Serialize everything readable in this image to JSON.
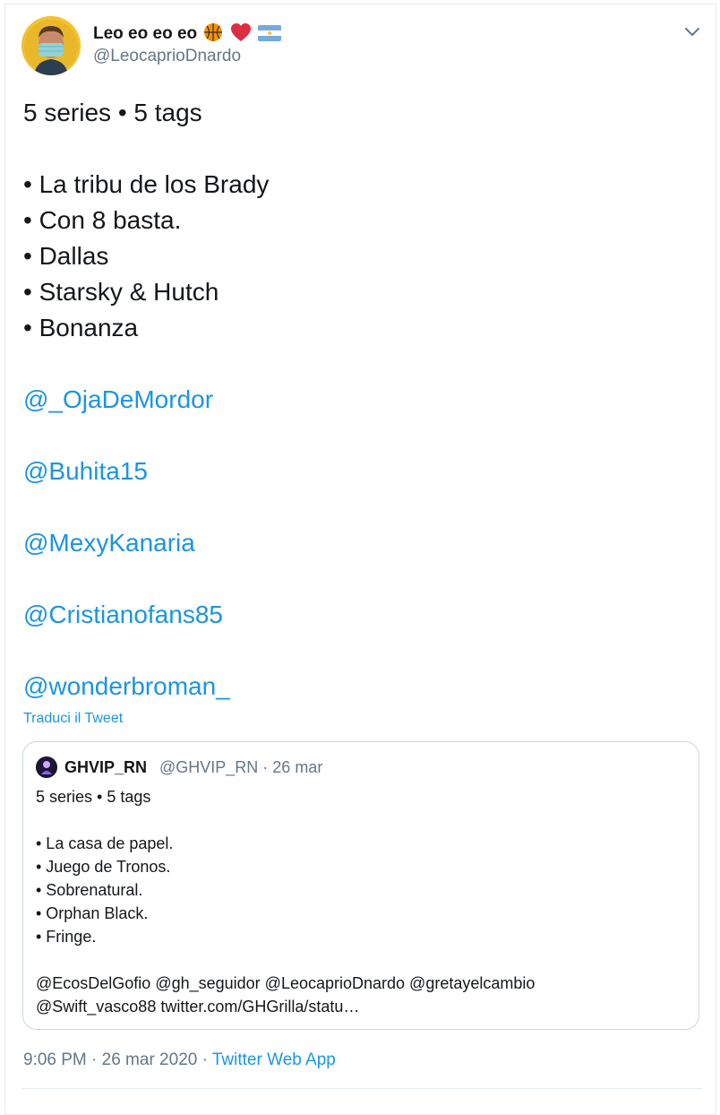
{
  "tweet": {
    "author": {
      "name": "Leo eo eo eo",
      "handle": "@LeocaprioDnardo",
      "name_emojis": [
        "basketball-icon",
        "red-heart-icon",
        "argentina-flag-icon"
      ]
    },
    "lines": [
      {
        "text": "5 series • 5 tags",
        "type": "text"
      },
      {
        "text": "",
        "type": "blank"
      },
      {
        "text": "• La tribu de los Brady",
        "type": "text"
      },
      {
        "text": "• Con 8 basta.",
        "type": "text"
      },
      {
        "text": "• Dallas",
        "type": "text"
      },
      {
        "text": "• Starsky & Hutch",
        "type": "text"
      },
      {
        "text": "• Bonanza",
        "type": "text"
      },
      {
        "text": "",
        "type": "blank"
      },
      {
        "text": "@_OjaDeMordor",
        "type": "mention"
      },
      {
        "text": "",
        "type": "blank"
      },
      {
        "text": "@Buhita15",
        "type": "mention"
      },
      {
        "text": "",
        "type": "blank"
      },
      {
        "text": "@MexyKanaria",
        "type": "mention"
      },
      {
        "text": "",
        "type": "blank"
      },
      {
        "text": "@Cristianofans85",
        "type": "mention"
      },
      {
        "text": "",
        "type": "blank"
      },
      {
        "text": "@wonderbroman_",
        "type": "mention"
      }
    ],
    "translate_label": "Traduci il Tweet",
    "quoted": {
      "name": "GHVIP_RN",
      "meta": "@GHVIP_RN · 26 mar",
      "lines": [
        "5 series • 5 tags",
        "",
        "• La casa de papel.",
        "• Juego de Tronos.",
        "• Sobrenatural.",
        "• Orphan Black.",
        "• Fringe.",
        "",
        "@EcosDelGofio @gh_seguidor @LeocaprioDnardo @gretayelcambio",
        "@Swift_vasco88 twitter.com/GHGrilla/statu…"
      ]
    },
    "timestamp": "9:06 PM · 26 mar 2020 · ",
    "source": "Twitter Web App"
  },
  "colors": {
    "link": "#1b95e0",
    "secondary_text": "#657786",
    "primary_text": "#14171a",
    "border": "#ccd6dd"
  }
}
